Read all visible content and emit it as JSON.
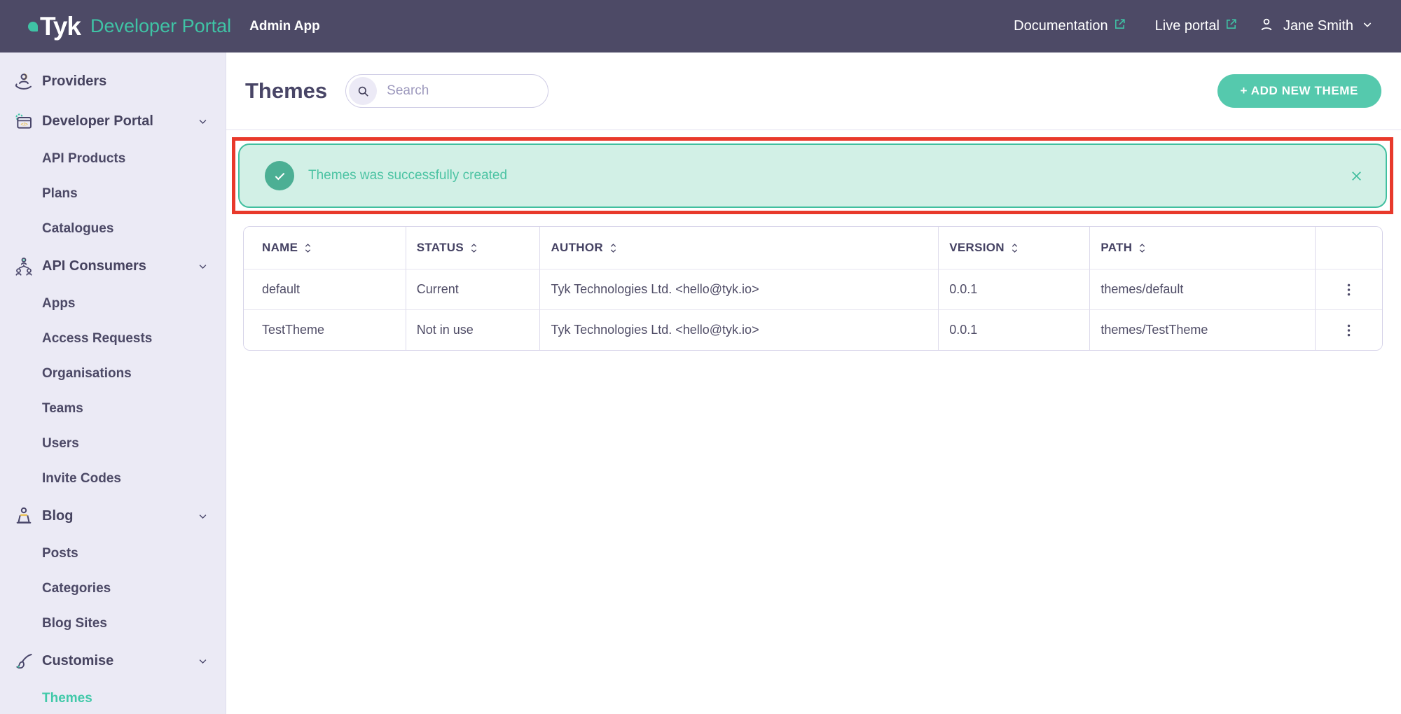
{
  "colors": {
    "navbar_bg": "#4d4a66",
    "brand_teal": "#3fc3a5",
    "sidebar_bg": "#ebeaf5",
    "active_item_teal": "#41c9a9",
    "add_button_bg": "#55c9ad",
    "alert_bg": "#d2f0e6",
    "alert_border": "#41bf9f",
    "alert_text": "#4cc3a3",
    "alert_check_bg": "#4caf94",
    "annotation_red": "#e8392b",
    "table_border": "#d7d4e9",
    "heading_text": "#484566"
  },
  "icons": {
    "navbar": [
      "external-link-icon",
      "user-icon",
      "chevron-down-icon"
    ],
    "sidebar": [
      "providers-icon",
      "developer-portal-icon",
      "api-consumers-icon",
      "blog-icon",
      "customise-icon",
      "chevron-down-icon"
    ],
    "main": [
      "search-icon",
      "check-circle-icon",
      "close-icon",
      "sort-icon",
      "kebab-menu-icon"
    ]
  },
  "navbar": {
    "logo_text": "Tyk",
    "logo_product": "Developer Portal",
    "app_label": "Admin App",
    "doc_link": "Documentation",
    "live_portal_link": "Live portal",
    "user_name": "Jane Smith"
  },
  "sidebar": {
    "items": [
      {
        "label": "Providers"
      },
      {
        "label": "Developer Portal"
      },
      {
        "label": "API Products"
      },
      {
        "label": "Plans"
      },
      {
        "label": "Catalogues"
      },
      {
        "label": "API Consumers"
      },
      {
        "label": "Apps"
      },
      {
        "label": "Access Requests"
      },
      {
        "label": "Organisations"
      },
      {
        "label": "Teams"
      },
      {
        "label": "Users"
      },
      {
        "label": "Invite Codes"
      },
      {
        "label": "Blog"
      },
      {
        "label": "Posts"
      },
      {
        "label": "Categories"
      },
      {
        "label": "Blog Sites"
      },
      {
        "label": "Customise"
      },
      {
        "label": "Themes"
      }
    ]
  },
  "main": {
    "title": "Themes",
    "search_placeholder": "Search",
    "add_button": "+ ADD NEW THEME",
    "alert": {
      "message": "Themes was successfully created"
    },
    "table": {
      "columns": [
        {
          "label": "NAME"
        },
        {
          "label": "STATUS"
        },
        {
          "label": "AUTHOR"
        },
        {
          "label": "VERSION"
        },
        {
          "label": "PATH"
        }
      ],
      "rows": [
        {
          "name": "default",
          "status": "Current",
          "author": "Tyk Technologies Ltd. <hello@tyk.io>",
          "version": "0.0.1",
          "path": "themes/default"
        },
        {
          "name": "TestTheme",
          "status": "Not in use",
          "author": "Tyk Technologies Ltd. <hello@tyk.io>",
          "version": "0.0.1",
          "path": "themes/TestTheme"
        }
      ]
    }
  }
}
